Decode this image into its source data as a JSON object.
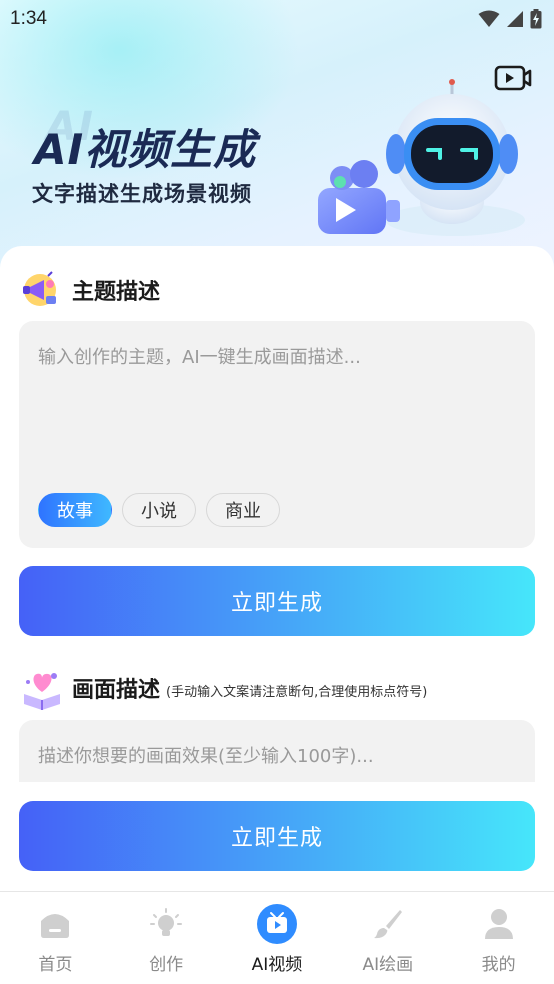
{
  "status_bar": {
    "time": "1:34"
  },
  "hero": {
    "title": "AI视频生成",
    "title_shadow": "AI",
    "subtitle": "文字描述生成场景视频"
  },
  "topic_section": {
    "title": "主题描述",
    "placeholder": "输入创作的主题，AI一键生成画面描述...",
    "chips": [
      {
        "label": "故事",
        "active": true
      },
      {
        "label": "小说",
        "active": false
      },
      {
        "label": "商业",
        "active": false
      }
    ],
    "generate_label": "立即生成"
  },
  "scene_section": {
    "title": "画面描述",
    "note": "(手动输入文案请注意断句,合理使用标点符号)",
    "placeholder": "描述你想要的画面效果(至少输入100字)...",
    "generate_label": "立即生成"
  },
  "bottom_nav": {
    "items": [
      {
        "label": "首页",
        "icon": "home-icon",
        "active": false
      },
      {
        "label": "创作",
        "icon": "lightbulb-icon",
        "active": false
      },
      {
        "label": "AI视频",
        "icon": "video-play-icon",
        "active": true
      },
      {
        "label": "AI绘画",
        "icon": "paintbrush-icon",
        "active": false
      },
      {
        "label": "我的",
        "icon": "person-icon",
        "active": false
      }
    ]
  },
  "colors": {
    "accent_start": "#4561f7",
    "accent_end": "#46e6fa",
    "chip_active_start": "#2f74ff",
    "chip_active_end": "#3fb8ff",
    "title_color": "#1a2a55",
    "nav_active_icon": "#2f8cff"
  }
}
